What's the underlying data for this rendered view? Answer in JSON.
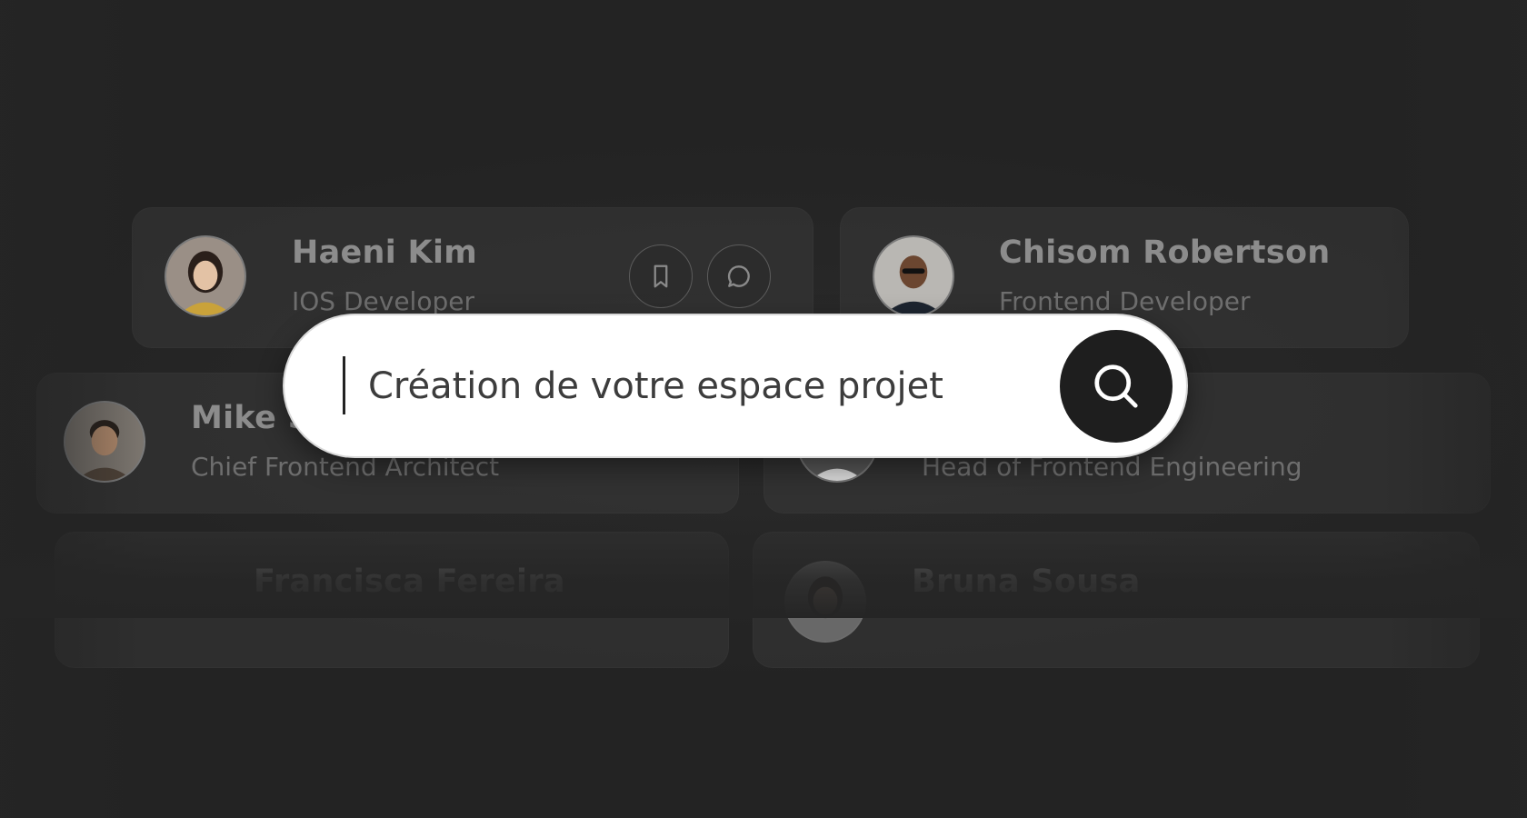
{
  "search": {
    "value": "Création de votre espace projet",
    "button_icon": "search-icon"
  },
  "actions": {
    "bookmark_icon": "bookmark-icon",
    "message_icon": "message-circle-icon"
  },
  "people": [
    {
      "name": "Haeni Kim",
      "role": "IOS Developer"
    },
    {
      "name": "Chisom Robertson",
      "role": "Frontend Developer"
    },
    {
      "name": "Mike S",
      "role": "Chief Frontend Architect"
    },
    {
      "name": "",
      "role": "Head of Frontend Engineering"
    },
    {
      "name": "Francisca Fereira",
      "role": ""
    },
    {
      "name": "Bruna Sousa",
      "role": ""
    }
  ],
  "colors": {
    "background": "#252525",
    "search_bg": "#ffffff",
    "search_button": "#1e1e1e"
  }
}
